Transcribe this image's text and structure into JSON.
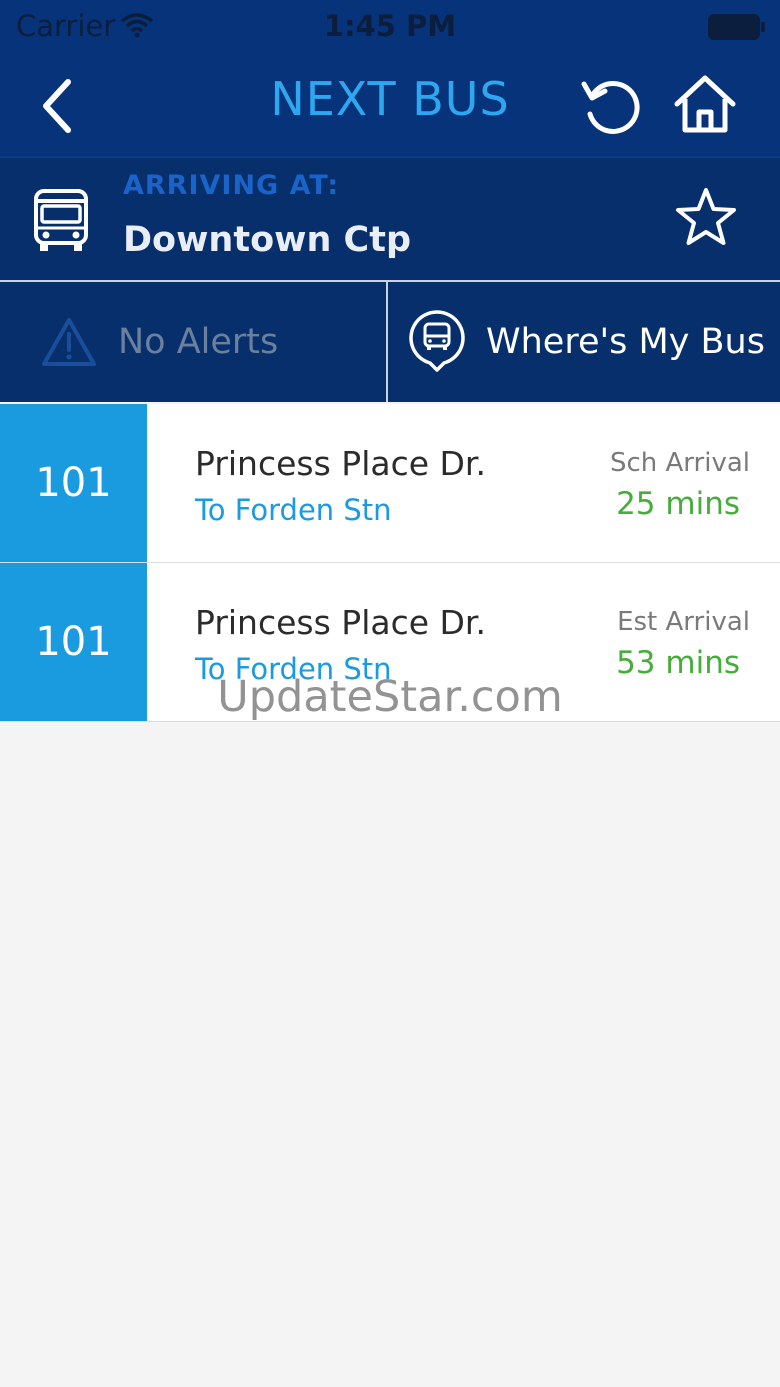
{
  "status_bar": {
    "carrier": "Carrier",
    "time": "1:45 PM"
  },
  "nav": {
    "title": "NEXT BUS"
  },
  "stop": {
    "arriving_label": "ARRIVING AT:",
    "name": "Downtown Ctp"
  },
  "actions": {
    "alerts_label": "No Alerts",
    "wheres_my_bus_label": "Where's My Bus"
  },
  "arrivals": [
    {
      "route": "101",
      "street": "Princess Place Dr.",
      "destination": "To Forden Stn",
      "arrival_type": "Sch Arrival",
      "eta": "25 mins"
    },
    {
      "route": "101",
      "street": "Princess Place Dr.",
      "destination": "To Forden Stn",
      "arrival_type": "Est Arrival",
      "eta": "53 mins"
    }
  ],
  "watermark": "UpdateStar.com",
  "colors": {
    "nav_background": "#07337a",
    "header_background": "#062f6c",
    "title_blue": "#2fa7f0",
    "route_badge": "#1a9be0",
    "eta_green": "#45ad3a"
  },
  "icons": [
    "wifi-icon",
    "battery-icon",
    "back-chevron-icon",
    "refresh-icon",
    "home-icon",
    "bus-icon",
    "star-icon",
    "alert-triangle-icon",
    "bus-location-icon"
  ]
}
